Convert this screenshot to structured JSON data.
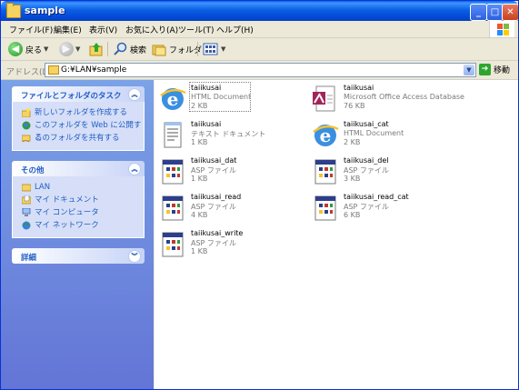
{
  "window": {
    "title": "sample"
  },
  "menu": [
    "ファイル(F)",
    "編集(E)",
    "表示(V)",
    "お気に入り(A)",
    "ツール(T)",
    "ヘルプ(H)"
  ],
  "toolbar": {
    "back": "戻る",
    "search": "検索",
    "folders": "フォルダ"
  },
  "address": {
    "label": "アドレス(D)",
    "path": "G:¥LAN¥sample",
    "go": "移動"
  },
  "tasks": {
    "file_tasks": {
      "title": "ファイルとフォルダのタスク",
      "items": [
        "新しいフォルダを作成する",
        "このフォルダを Web に公開する",
        "このフォルダを共有する"
      ]
    },
    "other": {
      "title": "その他",
      "items": [
        "LAN",
        "マイ ドキュメント",
        "マイ コンピュータ",
        "マイ ネットワーク"
      ]
    },
    "details": {
      "title": "詳細"
    }
  },
  "files": [
    {
      "name": "taiikusai",
      "type": "HTML Document",
      "size": "2 KB",
      "icon": "ie-html-icon"
    },
    {
      "name": "taiikusai",
      "type": "Microsoft Office Access Database",
      "size": "76 KB",
      "icon": "access-db-icon"
    },
    {
      "name": "taiikusai",
      "type": "テキスト ドキュメント",
      "size": "1 KB",
      "icon": "text-document-icon"
    },
    {
      "name": "taiikusai_cat",
      "type": "HTML Document",
      "size": "2 KB",
      "icon": "ie-html-icon"
    },
    {
      "name": "taiikusai_dat",
      "type": "ASP ファイル",
      "size": "1 KB",
      "icon": "asp-file-icon"
    },
    {
      "name": "taiikusai_del",
      "type": "ASP ファイル",
      "size": "3 KB",
      "icon": "asp-file-icon"
    },
    {
      "name": "taiikusai_read",
      "type": "ASP ファイル",
      "size": "4 KB",
      "icon": "asp-file-icon"
    },
    {
      "name": "taiikusai_read_cat",
      "type": "ASP ファイル",
      "size": "6 KB",
      "icon": "asp-file-icon"
    },
    {
      "name": "taiikusai_write",
      "type": "ASP ファイル",
      "size": "1 KB",
      "icon": "asp-file-icon"
    }
  ]
}
